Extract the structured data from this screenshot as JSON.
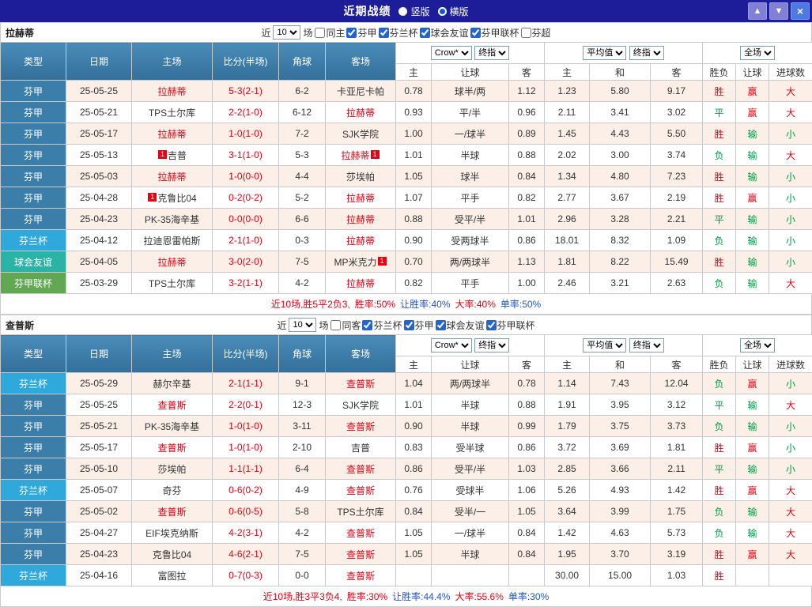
{
  "header": {
    "title": "近期战绩",
    "layout_options": [
      {
        "label": "竖版",
        "selected": false
      },
      {
        "label": "横版",
        "selected": true
      }
    ],
    "buttons": {
      "up": "▲",
      "down": "▼",
      "close": "×"
    }
  },
  "table_header": {
    "type": "类型",
    "date": "日期",
    "home": "主场",
    "score": "比分(半场)",
    "corner": "角球",
    "away": "客场",
    "asia_bookmaker": "Crow*",
    "asia_stage": "终指",
    "asia_sub": [
      "主",
      "让球",
      "客"
    ],
    "europe_bookmaker": "平均值",
    "europe_stage": "终指",
    "europe_sub": [
      "主",
      "和",
      "客"
    ],
    "result_scope": "全场",
    "result_sub": [
      "胜负",
      "让球",
      "进球数"
    ]
  },
  "league_colors": {
    "芬甲": "#3b7ea9",
    "芬兰杯": "#2fa8dc",
    "球会友谊": "#2bb3a5",
    "芬甲联杯": "#62a852"
  },
  "result_red_values": [
    "胜",
    "赢",
    "大"
  ],
  "colors": {
    "result_red": "#e60012",
    "result_green": "#009944"
  },
  "sections": [
    {
      "team": "拉赫蒂",
      "filter": {
        "prefix": "近",
        "count": "10",
        "suffix": "场",
        "checkboxes": [
          {
            "label": "同主",
            "checked": false
          },
          {
            "label": "芬甲",
            "checked": true
          },
          {
            "label": "芬兰杯",
            "checked": true
          },
          {
            "label": "球会友谊",
            "checked": true
          },
          {
            "label": "芬甲联杯",
            "checked": true
          },
          {
            "label": "芬超",
            "checked": false
          }
        ]
      },
      "rows": [
        {
          "type": "芬甲",
          "date": "25-05-25",
          "home": "拉赫蒂",
          "home_focus": true,
          "home_card_pre": "",
          "home_card_post": "",
          "score": "5-3(2-1)",
          "corner": "6-2",
          "away": "卡亚尼卡帕",
          "away_focus": false,
          "away_card_pre": "",
          "away_card_post": "",
          "asia": [
            "0.78",
            "球半/两",
            "1.12"
          ],
          "europe": [
            "1.23",
            "5.80",
            "9.17"
          ],
          "result": [
            "胜",
            "赢",
            "大"
          ]
        },
        {
          "type": "芬甲",
          "date": "25-05-21",
          "home": "TPS土尔库",
          "home_focus": false,
          "home_card_pre": "",
          "home_card_post": "",
          "score": "2-2(1-0)",
          "corner": "6-12",
          "away": "拉赫蒂",
          "away_focus": true,
          "away_card_pre": "",
          "away_card_post": "",
          "asia": [
            "0.93",
            "平/半",
            "0.96"
          ],
          "europe": [
            "2.11",
            "3.41",
            "3.02"
          ],
          "result": [
            "平",
            "赢",
            "大"
          ]
        },
        {
          "type": "芬甲",
          "date": "25-05-17",
          "home": "拉赫蒂",
          "home_focus": true,
          "home_card_pre": "",
          "home_card_post": "",
          "score": "1-0(1-0)",
          "corner": "7-2",
          "away": "SJK学院",
          "away_focus": false,
          "away_card_pre": "",
          "away_card_post": "",
          "asia": [
            "1.00",
            "一/球半",
            "0.89"
          ],
          "europe": [
            "1.45",
            "4.43",
            "5.50"
          ],
          "result": [
            "胜",
            "输",
            "小"
          ]
        },
        {
          "type": "芬甲",
          "date": "25-05-13",
          "home": "吉普",
          "home_focus": false,
          "home_card_pre": "1",
          "home_card_post": "",
          "score": "3-1(1-0)",
          "corner": "5-3",
          "away": "拉赫蒂",
          "away_focus": true,
          "away_card_pre": "",
          "away_card_post": "1",
          "asia": [
            "1.01",
            "半球",
            "0.88"
          ],
          "europe": [
            "2.02",
            "3.00",
            "3.74"
          ],
          "result": [
            "负",
            "输",
            "大"
          ]
        },
        {
          "type": "芬甲",
          "date": "25-05-03",
          "home": "拉赫蒂",
          "home_focus": true,
          "home_card_pre": "",
          "home_card_post": "",
          "score": "1-0(0-0)",
          "corner": "4-4",
          "away": "莎埃帕",
          "away_focus": false,
          "away_card_pre": "",
          "away_card_post": "",
          "asia": [
            "1.05",
            "球半",
            "0.84"
          ],
          "europe": [
            "1.34",
            "4.80",
            "7.23"
          ],
          "result": [
            "胜",
            "输",
            "小"
          ]
        },
        {
          "type": "芬甲",
          "date": "25-04-28",
          "home": "克鲁比04",
          "home_focus": false,
          "home_card_pre": "1",
          "home_card_post": "",
          "score": "0-2(0-2)",
          "corner": "5-2",
          "away": "拉赫蒂",
          "away_focus": true,
          "away_card_pre": "",
          "away_card_post": "",
          "asia": [
            "1.07",
            "平手",
            "0.82"
          ],
          "europe": [
            "2.77",
            "3.67",
            "2.19"
          ],
          "result": [
            "胜",
            "赢",
            "小"
          ]
        },
        {
          "type": "芬甲",
          "date": "25-04-23",
          "home": "PK-35海辛基",
          "home_focus": false,
          "home_card_pre": "",
          "home_card_post": "",
          "score": "0-0(0-0)",
          "corner": "6-6",
          "away": "拉赫蒂",
          "away_focus": true,
          "away_card_pre": "",
          "away_card_post": "",
          "asia": [
            "0.88",
            "受平/半",
            "1.01"
          ],
          "europe": [
            "2.96",
            "3.28",
            "2.21"
          ],
          "result": [
            "平",
            "输",
            "小"
          ]
        },
        {
          "type": "芬兰杯",
          "date": "25-04-12",
          "home": "拉迪恩雷帕斯",
          "home_focus": false,
          "home_card_pre": "",
          "home_card_post": "",
          "score": "2-1(1-0)",
          "corner": "0-3",
          "away": "拉赫蒂",
          "away_focus": true,
          "away_card_pre": "",
          "away_card_post": "",
          "asia": [
            "0.90",
            "受两球半",
            "0.86"
          ],
          "europe": [
            "18.01",
            "8.32",
            "1.09"
          ],
          "result": [
            "负",
            "输",
            "小"
          ]
        },
        {
          "type": "球会友谊",
          "date": "25-04-05",
          "home": "拉赫蒂",
          "home_focus": true,
          "home_card_pre": "",
          "home_card_post": "",
          "score": "3-0(2-0)",
          "corner": "7-5",
          "away": "MP米克力",
          "away_focus": false,
          "away_card_pre": "",
          "away_card_post": "1",
          "asia": [
            "0.70",
            "两/两球半",
            "1.13"
          ],
          "europe": [
            "1.81",
            "8.22",
            "15.49"
          ],
          "result": [
            "胜",
            "输",
            "小"
          ]
        },
        {
          "type": "芬甲联杯",
          "date": "25-03-29",
          "home": "TPS土尔库",
          "home_focus": false,
          "home_card_pre": "",
          "home_card_post": "",
          "score": "3-2(1-1)",
          "corner": "4-2",
          "away": "拉赫蒂",
          "away_focus": true,
          "away_card_pre": "",
          "away_card_post": "",
          "asia": [
            "0.82",
            "平手",
            "1.00"
          ],
          "europe": [
            "2.46",
            "3.21",
            "2.63"
          ],
          "result": [
            "负",
            "输",
            "大"
          ]
        }
      ],
      "summary": [
        {
          "text": "近10场,胜5平2负3,",
          "color": "#e60012"
        },
        {
          "text": "胜率:50%",
          "color": "#e60012"
        },
        {
          "text": "让胜率:40%",
          "color": "#2553c4"
        },
        {
          "text": "大率:40%",
          "color": "#e60012"
        },
        {
          "text": "单率:50%",
          "color": "#2553c4"
        }
      ]
    },
    {
      "team": "查普斯",
      "filter": {
        "prefix": "近",
        "count": "10",
        "suffix": "场",
        "checkboxes": [
          {
            "label": "同客",
            "checked": false
          },
          {
            "label": "芬兰杯",
            "checked": true
          },
          {
            "label": "芬甲",
            "checked": true
          },
          {
            "label": "球会友谊",
            "checked": true
          },
          {
            "label": "芬甲联杯",
            "checked": true
          }
        ]
      },
      "rows": [
        {
          "type": "芬兰杯",
          "date": "25-05-29",
          "home": "赫尔辛基",
          "home_focus": false,
          "home_card_pre": "",
          "home_card_post": "",
          "score": "2-1(1-1)",
          "corner": "9-1",
          "away": "查普斯",
          "away_focus": true,
          "away_card_pre": "",
          "away_card_post": "",
          "asia": [
            "1.04",
            "两/两球半",
            "0.78"
          ],
          "europe": [
            "1.14",
            "7.43",
            "12.04"
          ],
          "result": [
            "负",
            "赢",
            "小"
          ]
        },
        {
          "type": "芬甲",
          "date": "25-05-25",
          "home": "查普斯",
          "home_focus": true,
          "home_card_pre": "",
          "home_card_post": "",
          "score": "2-2(0-1)",
          "corner": "12-3",
          "away": "SJK学院",
          "away_focus": false,
          "away_card_pre": "",
          "away_card_post": "",
          "asia": [
            "1.01",
            "半球",
            "0.88"
          ],
          "europe": [
            "1.91",
            "3.95",
            "3.12"
          ],
          "result": [
            "平",
            "输",
            "大"
          ]
        },
        {
          "type": "芬甲",
          "date": "25-05-21",
          "home": "PK-35海辛基",
          "home_focus": false,
          "home_card_pre": "",
          "home_card_post": "",
          "score": "1-0(1-0)",
          "corner": "3-11",
          "away": "查普斯",
          "away_focus": true,
          "away_card_pre": "",
          "away_card_post": "",
          "asia": [
            "0.90",
            "半球",
            "0.99"
          ],
          "europe": [
            "1.79",
            "3.75",
            "3.73"
          ],
          "result": [
            "负",
            "输",
            "小"
          ]
        },
        {
          "type": "芬甲",
          "date": "25-05-17",
          "home": "查普斯",
          "home_focus": true,
          "home_card_pre": "",
          "home_card_post": "",
          "score": "1-0(1-0)",
          "corner": "2-10",
          "away": "吉普",
          "away_focus": false,
          "away_card_pre": "",
          "away_card_post": "",
          "asia": [
            "0.83",
            "受半球",
            "0.86"
          ],
          "europe": [
            "3.72",
            "3.69",
            "1.81"
          ],
          "result": [
            "胜",
            "赢",
            "小"
          ]
        },
        {
          "type": "芬甲",
          "date": "25-05-10",
          "home": "莎埃帕",
          "home_focus": false,
          "home_card_pre": "",
          "home_card_post": "",
          "score": "1-1(1-1)",
          "corner": "6-4",
          "away": "查普斯",
          "away_focus": true,
          "away_card_pre": "",
          "away_card_post": "",
          "asia": [
            "0.86",
            "受平/半",
            "1.03"
          ],
          "europe": [
            "2.85",
            "3.66",
            "2.11"
          ],
          "result": [
            "平",
            "输",
            "小"
          ]
        },
        {
          "type": "芬兰杯",
          "date": "25-05-07",
          "home": "奇芬",
          "home_focus": false,
          "home_card_pre": "",
          "home_card_post": "",
          "score": "0-6(0-2)",
          "corner": "4-9",
          "away": "查普斯",
          "away_focus": true,
          "away_card_pre": "",
          "away_card_post": "",
          "asia": [
            "0.76",
            "受球半",
            "1.06"
          ],
          "europe": [
            "5.26",
            "4.93",
            "1.42"
          ],
          "result": [
            "胜",
            "赢",
            "大"
          ]
        },
        {
          "type": "芬甲",
          "date": "25-05-02",
          "home": "查普斯",
          "home_focus": true,
          "home_card_pre": "",
          "home_card_post": "",
          "score": "0-6(0-5)",
          "corner": "5-8",
          "away": "TPS土尔库",
          "away_focus": false,
          "away_card_pre": "",
          "away_card_post": "",
          "asia": [
            "0.84",
            "受半/一",
            "1.05"
          ],
          "europe": [
            "3.64",
            "3.99",
            "1.75"
          ],
          "result": [
            "负",
            "输",
            "大"
          ]
        },
        {
          "type": "芬甲",
          "date": "25-04-27",
          "home": "EIF埃克纳斯",
          "home_focus": false,
          "home_card_pre": "",
          "home_card_post": "",
          "score": "4-2(3-1)",
          "corner": "4-2",
          "away": "查普斯",
          "away_focus": true,
          "away_card_pre": "",
          "away_card_post": "",
          "asia": [
            "1.05",
            "一/球半",
            "0.84"
          ],
          "europe": [
            "1.42",
            "4.63",
            "5.73"
          ],
          "result": [
            "负",
            "输",
            "大"
          ]
        },
        {
          "type": "芬甲",
          "date": "25-04-23",
          "home": "克鲁比04",
          "home_focus": false,
          "home_card_pre": "",
          "home_card_post": "",
          "score": "4-6(2-1)",
          "corner": "7-5",
          "away": "查普斯",
          "away_focus": true,
          "away_card_pre": "",
          "away_card_post": "",
          "asia": [
            "1.05",
            "半球",
            "0.84"
          ],
          "europe": [
            "1.95",
            "3.70",
            "3.19"
          ],
          "result": [
            "胜",
            "赢",
            "大"
          ]
        },
        {
          "type": "芬兰杯",
          "date": "25-04-16",
          "home": "富图拉",
          "home_focus": false,
          "home_card_pre": "",
          "home_card_post": "",
          "score": "0-7(0-3)",
          "corner": "0-0",
          "away": "查普斯",
          "away_focus": true,
          "away_card_pre": "",
          "away_card_post": "",
          "asia": [
            "",
            "",
            ""
          ],
          "europe": [
            "30.00",
            "15.00",
            "1.03"
          ],
          "result": [
            "胜",
            "",
            ""
          ]
        }
      ],
      "summary": [
        {
          "text": "近10场,胜3平3负4,",
          "color": "#e60012"
        },
        {
          "text": "胜率:30%",
          "color": "#e60012"
        },
        {
          "text": "让胜率:44.4%",
          "color": "#2553c4"
        },
        {
          "text": "大率:55.6%",
          "color": "#e60012"
        },
        {
          "text": "单率:30%",
          "color": "#2553c4"
        }
      ]
    }
  ]
}
